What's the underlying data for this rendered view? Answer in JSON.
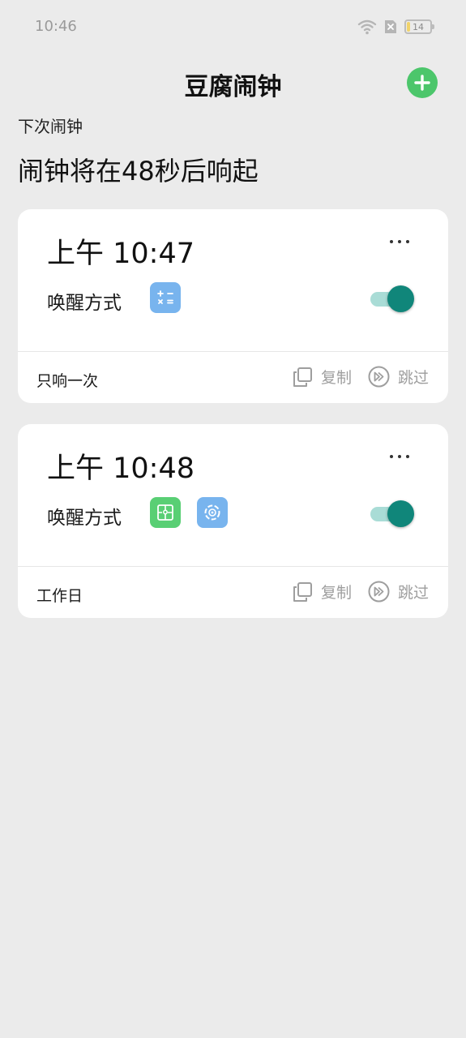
{
  "status_bar": {
    "time": "10:46",
    "battery": "14",
    "battery_level": 0.14
  },
  "header": {
    "title": "豆腐闹钟",
    "add_icon": "plus-icon",
    "accent": "#4cc66b"
  },
  "next_alarm": {
    "label": "下次闹钟",
    "countdown": "闹钟将在48秒后响起"
  },
  "alarms": [
    {
      "time": "上午 10:47",
      "wake_label": "唤醒方式",
      "methods": [
        {
          "icon": "math-calc-icon",
          "color": "#78b4ee"
        }
      ],
      "enabled": true,
      "repeat": "只响一次",
      "copy": "复制",
      "skip": "跳过"
    },
    {
      "time": "上午 10:48",
      "wake_label": "唤醒方式",
      "methods": [
        {
          "icon": "puzzle-icon",
          "color": "#59cf74"
        },
        {
          "icon": "memory-icon",
          "color": "#78b4ee"
        }
      ],
      "enabled": true,
      "repeat": "工作日",
      "copy": "复制",
      "skip": "跳过"
    }
  ],
  "colors": {
    "toggle_on": "#10867a",
    "toggle_track": "#a9dcd6",
    "background": "#ebebeb"
  }
}
